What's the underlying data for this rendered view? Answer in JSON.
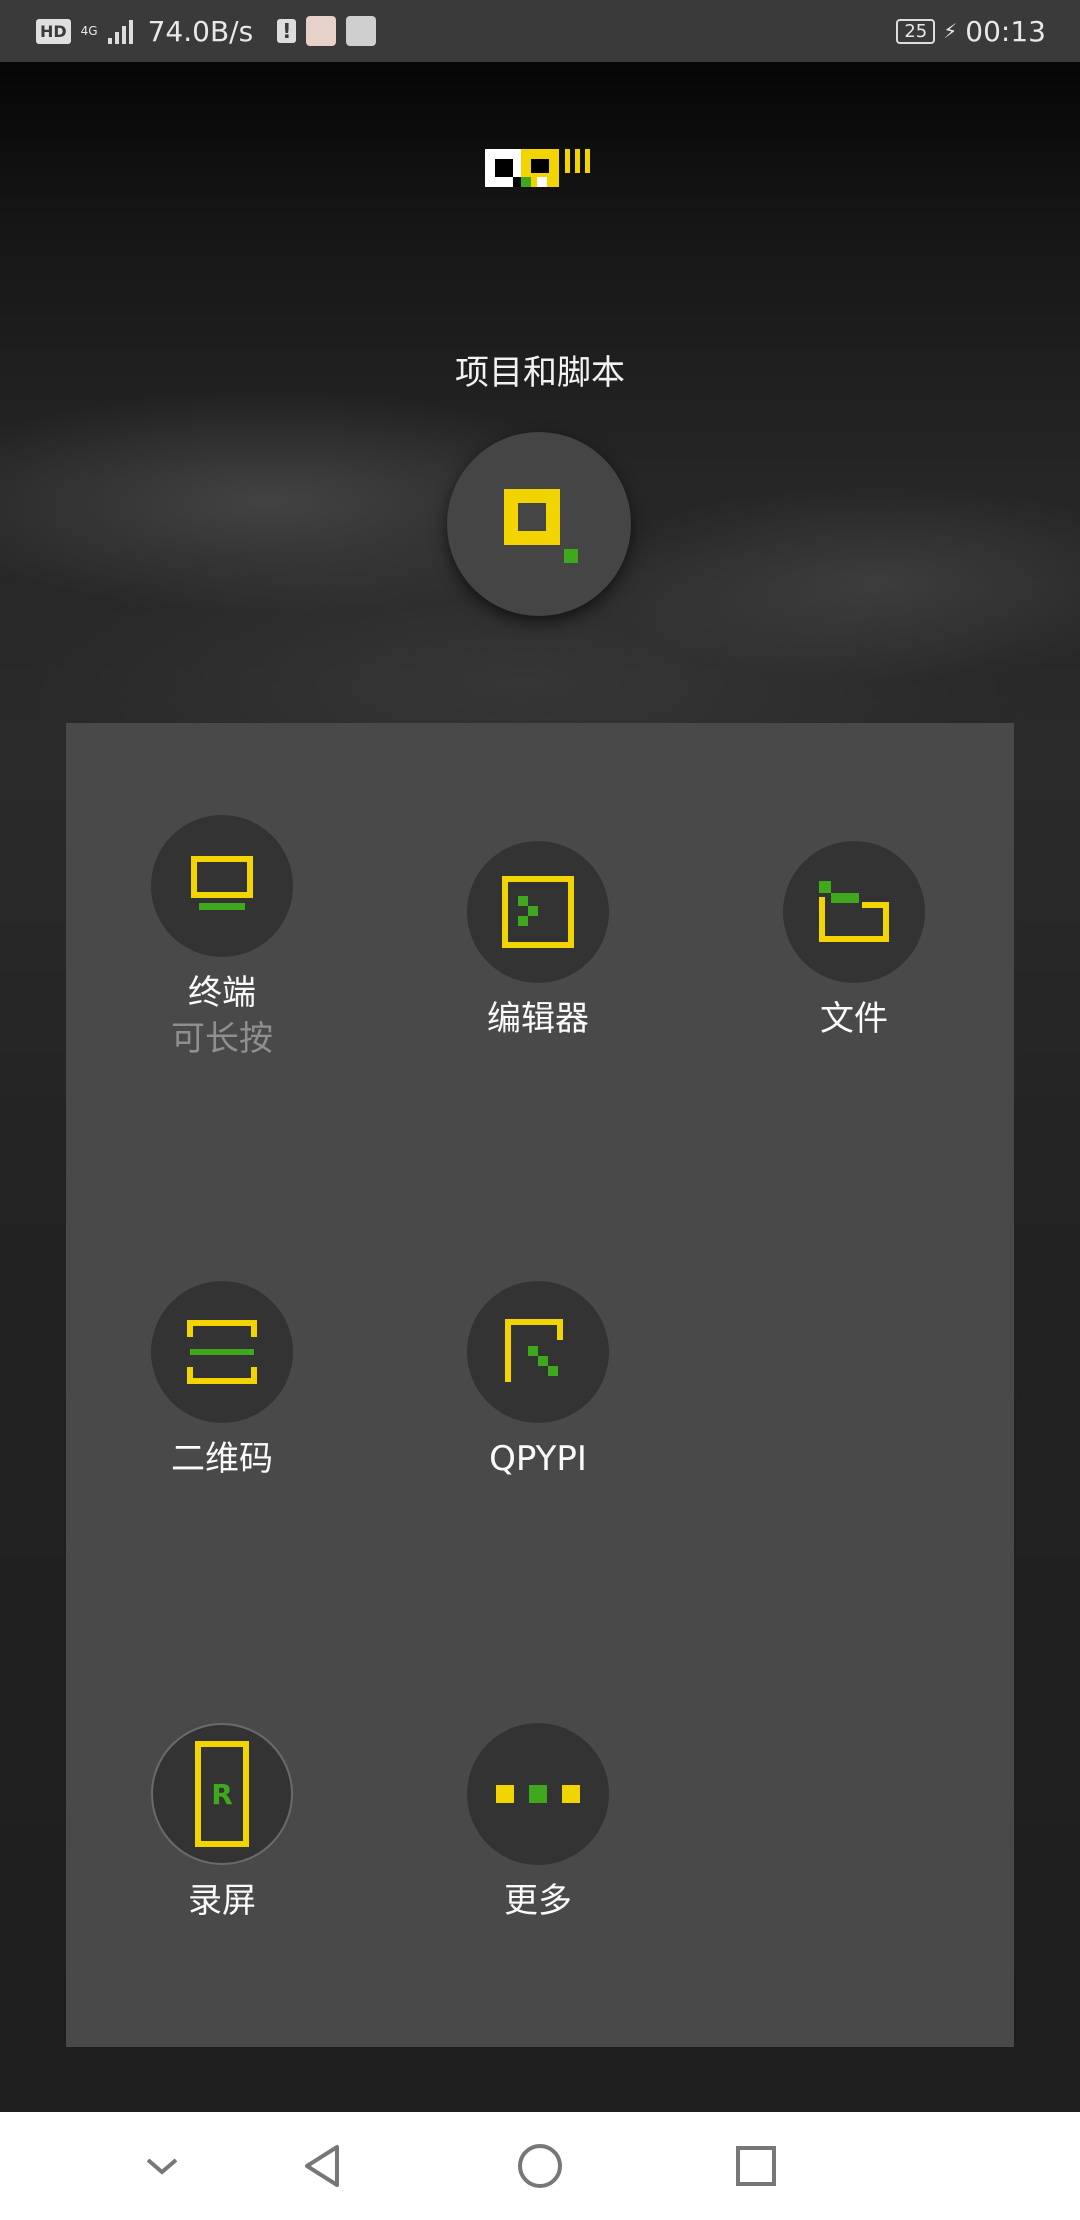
{
  "status_bar": {
    "network_badge": "HD",
    "signal_label": "4G",
    "speed": "74.0B/s",
    "alert_glyph": "!",
    "battery_level": "25",
    "time": "00:13"
  },
  "header": {
    "section_title": "项目和脚本"
  },
  "grid": {
    "terminal": {
      "label": "终端",
      "sublabel": "可长按"
    },
    "editor": {
      "label": "编辑器"
    },
    "files": {
      "label": "文件"
    },
    "qrcode": {
      "label": "二维码"
    },
    "qpypi": {
      "label": "QPYPI"
    },
    "record": {
      "label": "录屏",
      "icon_letter": "R"
    },
    "more": {
      "label": "更多"
    }
  },
  "colors": {
    "accent_yellow": "#f2d400",
    "accent_green": "#3fa81c",
    "panel": "#494949",
    "circle": "#333333"
  },
  "icons": {
    "hero": "project-icon",
    "terminal": "monitor-icon",
    "editor": "editor-icon",
    "files": "folder-icon",
    "qrcode": "scan-icon",
    "qpypi": "package-icon",
    "record": "record-icon",
    "more": "more-icon"
  }
}
